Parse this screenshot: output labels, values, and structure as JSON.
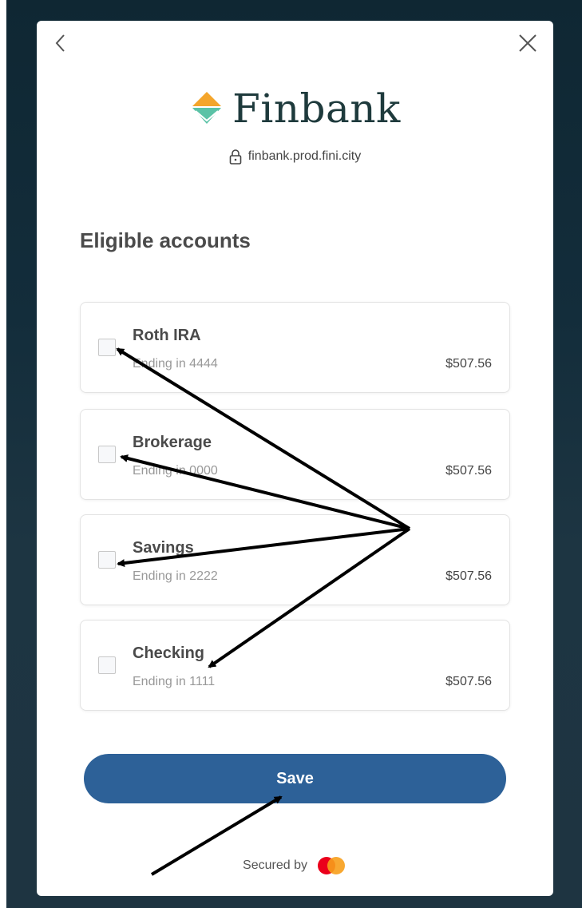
{
  "bank": {
    "name": "Finbank",
    "domain": "finbank.prod.fini.city"
  },
  "section_title": "Eligible accounts",
  "accounts": [
    {
      "name": "Roth IRA",
      "ending": "Ending in 4444",
      "balance": "$507.56",
      "checked": false
    },
    {
      "name": "Brokerage",
      "ending": "Ending in 0000",
      "balance": "$507.56",
      "checked": false
    },
    {
      "name": "Savings",
      "ending": "Ending in 2222",
      "balance": "$507.56",
      "checked": false
    },
    {
      "name": "Checking",
      "ending": "Ending in 1111",
      "balance": "$507.56",
      "checked": false
    }
  ],
  "save_label": "Save",
  "secured_by": "Secured by",
  "icons": {
    "back": "chevron-left-icon",
    "close": "close-icon",
    "lock": "lock-icon",
    "logo": "finbank-logo",
    "secure_brand": "mastercard-logo"
  },
  "colors": {
    "primary": "#2d6198",
    "brand_text": "#1e3a3c",
    "logo_orange": "#f4a52b",
    "logo_teal": "#5ac2a6",
    "mc_red": "#eb001b",
    "mc_yellow": "#f79e1b"
  }
}
